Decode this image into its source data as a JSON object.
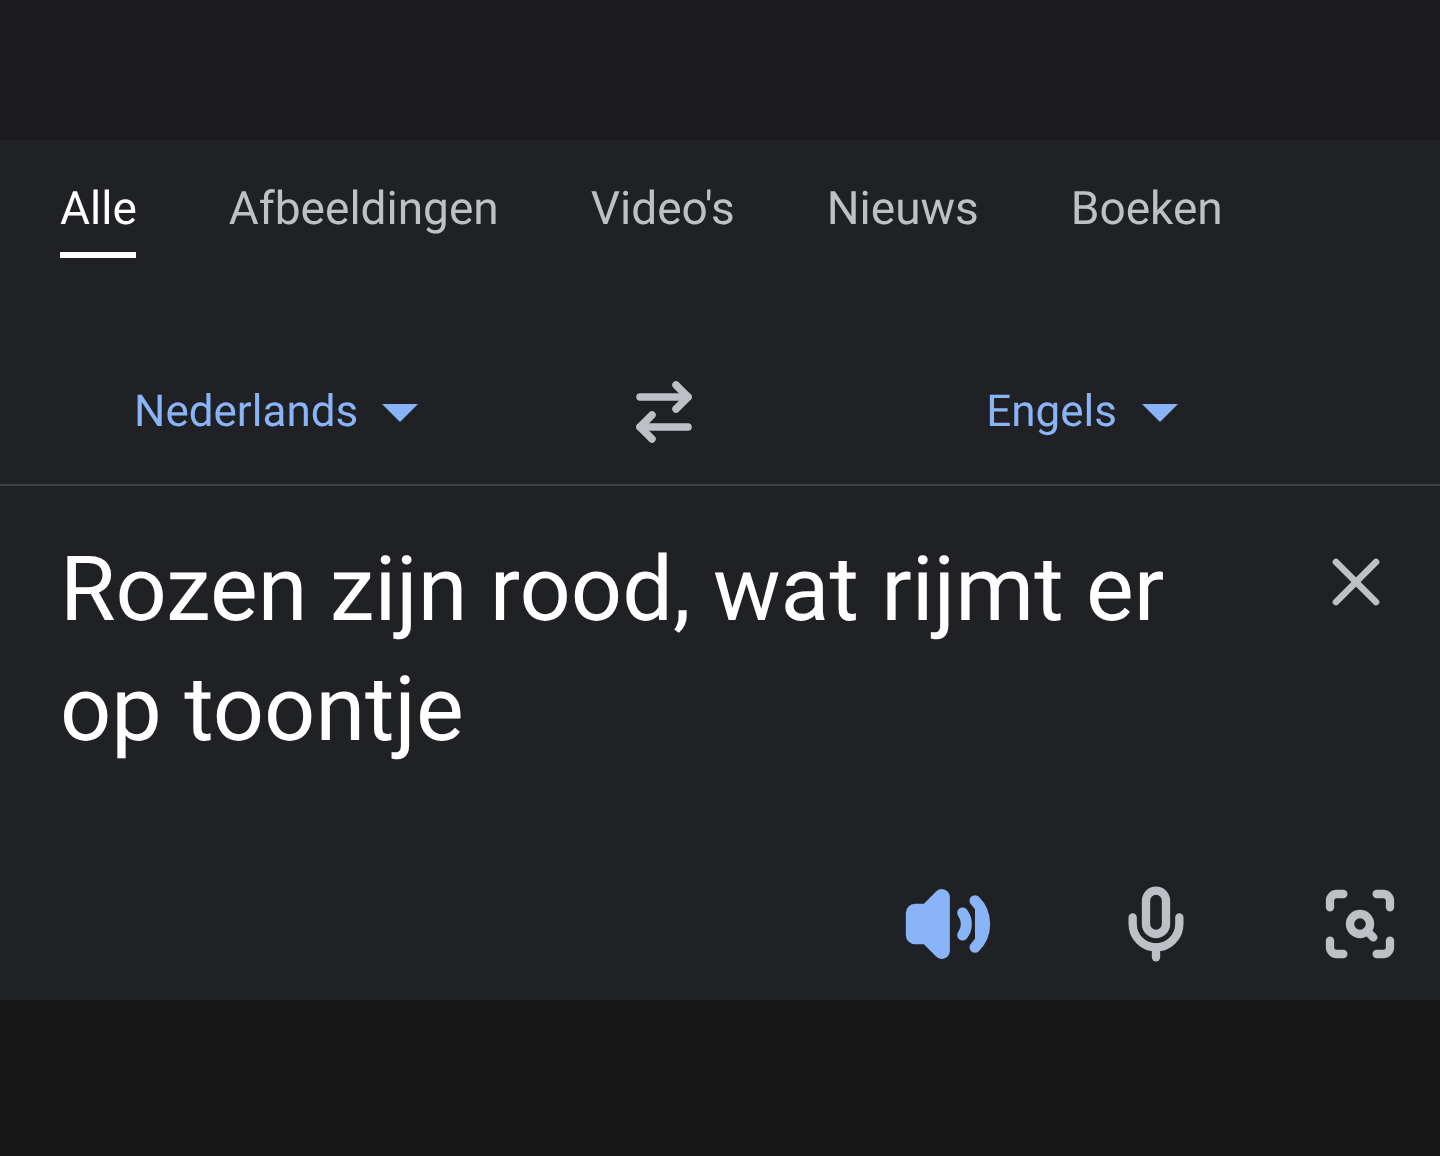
{
  "tabs": [
    {
      "label": "Alle",
      "selected": true
    },
    {
      "label": "Afbeeldingen",
      "selected": false
    },
    {
      "label": "Video's",
      "selected": false
    },
    {
      "label": "Nieuws",
      "selected": false
    },
    {
      "label": "Boeken",
      "selected": false
    }
  ],
  "languages": {
    "source": "Nederlands",
    "target": "Engels"
  },
  "input": {
    "value": "Rozen zijn rood, wat rijmt er op toontje"
  }
}
